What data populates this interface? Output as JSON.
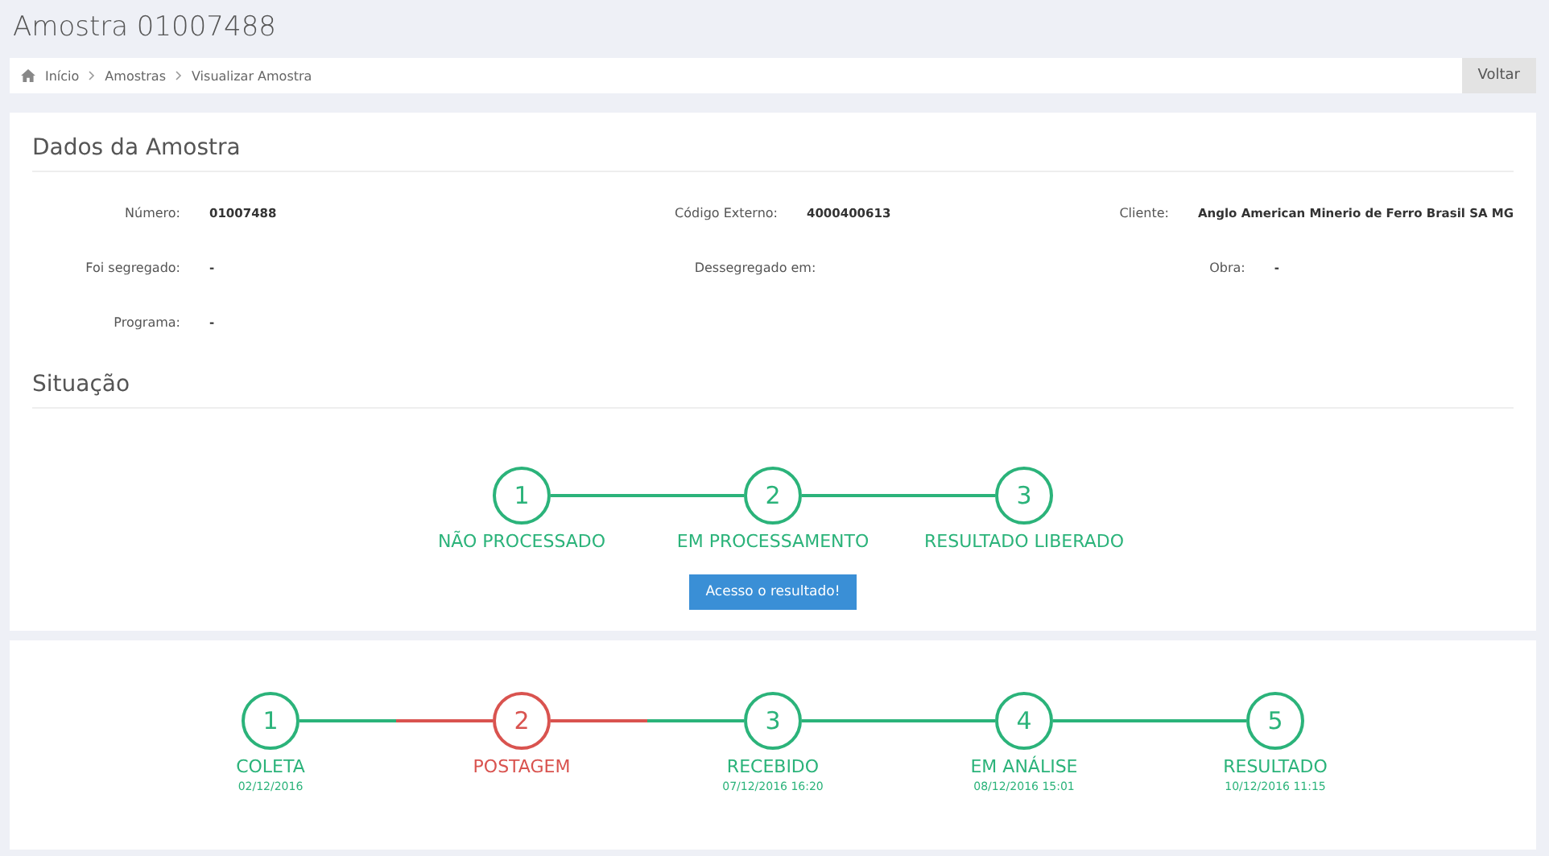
{
  "page_title": "Amostra 01007488",
  "breadcrumb": [
    "Início",
    "Amostras",
    "Visualizar Amostra"
  ],
  "back_button": "Voltar",
  "details": {
    "title": "Dados da Amostra",
    "fields": [
      {
        "label": "Número:",
        "value": "01007488"
      },
      {
        "label": "Código Externo:",
        "value": "4000400613"
      },
      {
        "label": "Cliente:",
        "value": "Anglo American Minerio de Ferro Brasil SA MG"
      },
      {
        "label": "Foi segregado:",
        "value": "-"
      },
      {
        "label": "Dessegregado em:"
      },
      {
        "label": "Obra:",
        "value": "-"
      },
      {
        "label": "Programa:",
        "value": "-"
      }
    ]
  },
  "status": {
    "title": "Situação",
    "steps": [
      {
        "number": "1",
        "label": "NÃO PROCESSADO",
        "failed": false
      },
      {
        "number": "2",
        "label": "EM PROCESSAMENTO",
        "failed": false
      },
      {
        "number": "3",
        "label": "RESULTADO LIBERADO",
        "failed": false
      }
    ],
    "result_button": "Acesso o resultado!"
  },
  "tracking": {
    "steps": [
      {
        "number": "1",
        "label": "COLETA",
        "date": "02/12/2016",
        "failed": false
      },
      {
        "number": "2",
        "label": "POSTAGEM",
        "failed": true
      },
      {
        "number": "3",
        "label": "RECEBIDO",
        "date": "07/12/2016 16:20",
        "failed": false
      },
      {
        "number": "4",
        "label": "EM ANÁLISE",
        "date": "08/12/2016 15:01",
        "failed": false
      },
      {
        "number": "5",
        "label": "RESULTADO",
        "date": "10/12/2016 11:15",
        "failed": false
      }
    ]
  }
}
